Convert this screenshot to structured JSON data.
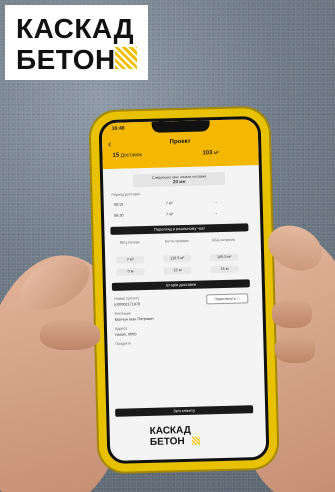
{
  "brand": {
    "logo_line1": "КАСКАД",
    "logo_line2": "БЕТОН",
    "accent": "#f2c000"
  },
  "app": {
    "time": "16:49",
    "title": "Проект",
    "tabs": [
      {
        "num": "15",
        "label": "Доставок"
      },
      {
        "num": "103",
        "label": "м³"
      }
    ],
    "next_delivery_label": "Следующее окно начала поставки",
    "next_delivery_value": "20 мн",
    "schedule_label": "Период доставки",
    "schedule_rows": [
      {
        "time": "08:15",
        "volume": "7 м³"
      },
      {
        "time": "09:30",
        "volume": "7 м³"
      }
    ],
    "realtime_button": "Перегляд в реальному часі",
    "columns": [
      {
        "head": "ВБЦ\nНатура"
      },
      {
        "head": "Бетон\nпреміум"
      },
      {
        "head": "ББЦ\nнатураль"
      }
    ],
    "cells_row1": [
      "3 м³",
      "110.5 м³",
      "105.5 м³"
    ],
    "cells_row2": [
      "0 м",
      "15 м",
      "15 м"
    ],
    "history_button": "Історія доставки",
    "project_number_label": "Номер проекту",
    "project_number": "КЛ0002171978",
    "favourite_button": "Переглянути",
    "manager_label": "Бетонщик",
    "manager_name": "Молчун Іван Петрович",
    "address_label": "Адреса",
    "address": "Ізмаїл, 0000",
    "product_label": "Продукти",
    "call_button": "Зв'я клієнту",
    "footer_logo_line1": "КАСКАД",
    "footer_logo_line2": "БЕТОН"
  }
}
